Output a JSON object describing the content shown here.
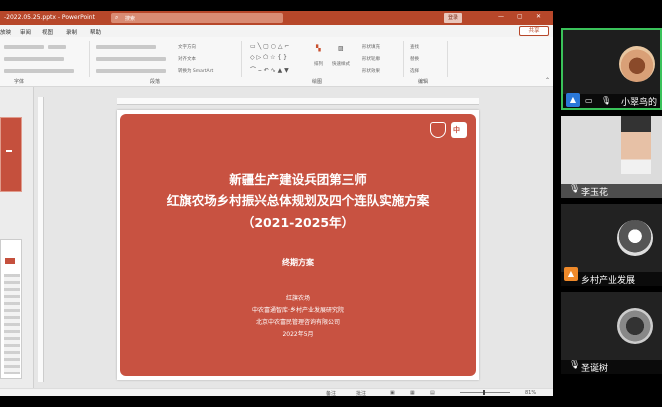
{
  "ppt": {
    "filename": "-2022.05.25.pptx - PowerPoint",
    "search_placeholder": "搜索",
    "login": "登录",
    "window_controls": [
      "—",
      "▢",
      "✕"
    ],
    "menu": [
      "放映",
      "审阅",
      "视图",
      "录制",
      "帮助"
    ],
    "share": "共享",
    "ribbon": {
      "group_labels": [
        "字体",
        "段落",
        "绘图",
        "编辑"
      ],
      "text_dir": "文字方向",
      "align_text": "对齐文本",
      "smartart": "转换为 SmartArt",
      "arrange": "排列",
      "quick_styles": "快速样式",
      "shape_fill": "形状填充",
      "shape_outline": "形状轮廓",
      "shape_effects": "形状效果",
      "find": "查找",
      "replace": "替换",
      "select": "选择"
    },
    "slide": {
      "title_line1": "新疆生产建设兵团第三师",
      "title_line2": "红旗农场乡村振兴总体规划及四个连队实施方案",
      "title_line3": "（2021-2025年）",
      "subtitle": "终期方案",
      "org1": "红旗农场",
      "org2": "中农富通智库·乡村产业发展研究院",
      "org3": "北京中农富民管理咨询有限公司",
      "date": "2022年5月",
      "logo2_glyph": "中"
    },
    "status": {
      "notes": "备注",
      "comments": "批注",
      "zoom": "81%"
    }
  },
  "participants": [
    {
      "name": "小翠鸟的"
    },
    {
      "name": "李玉花"
    },
    {
      "name": "乡村产业发展"
    },
    {
      "name": "圣诞树"
    }
  ],
  "colors": {
    "slide_red": "#c85241",
    "title_red": "#b7472a",
    "active_green": "#3ac25a",
    "badge_blue": "#2a78d8",
    "badge_orange": "#f08a2a"
  }
}
